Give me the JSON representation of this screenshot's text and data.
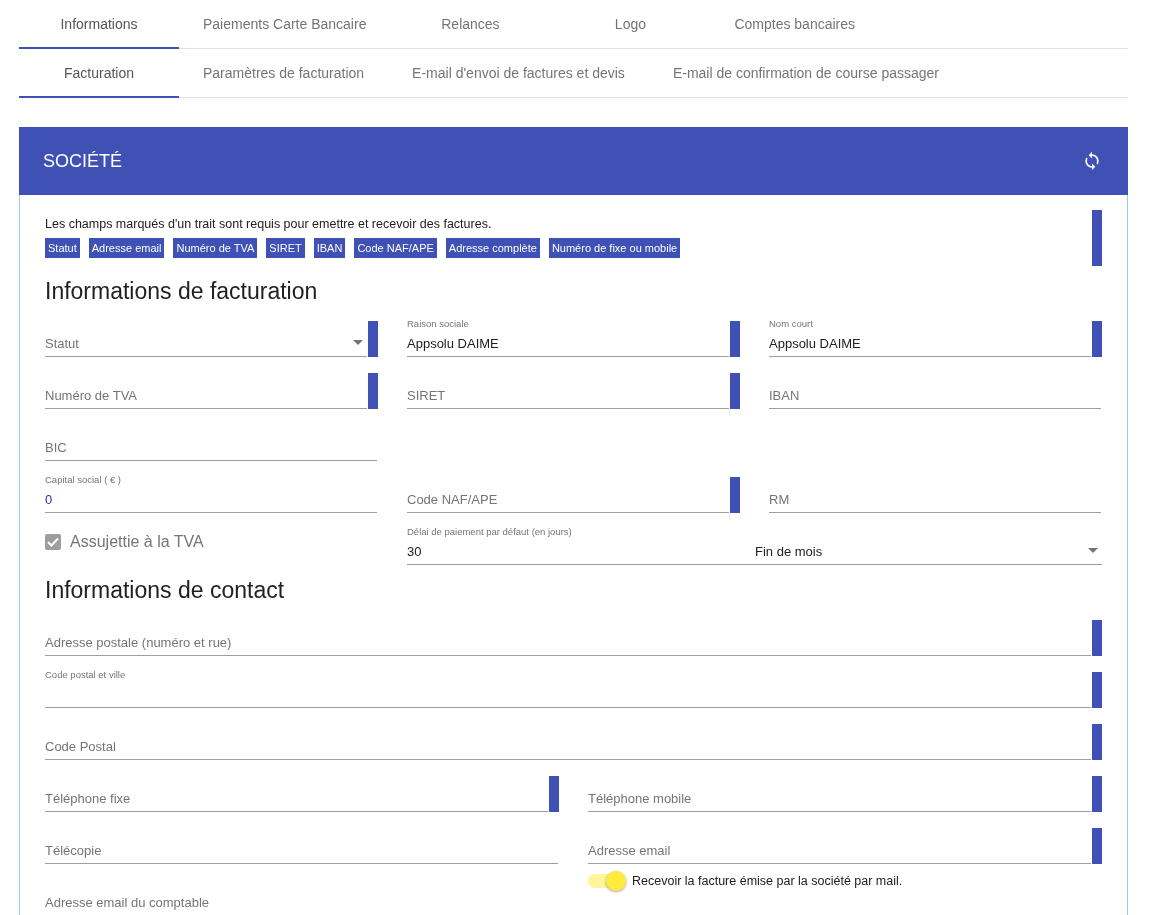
{
  "main_tabs": [
    {
      "label": "Informations",
      "selected": true
    },
    {
      "label": "Paiements Carte Bancaire",
      "selected": false
    },
    {
      "label": "Relances",
      "selected": false
    },
    {
      "label": "Logo",
      "selected": false
    },
    {
      "label": "Comptes bancaires",
      "selected": false
    }
  ],
  "sub_tabs": [
    {
      "label": "Facturation",
      "selected": true
    },
    {
      "label": "Paramètres de facturation",
      "selected": false
    },
    {
      "label": "E-mail d'envoi de factures et devis",
      "selected": false
    },
    {
      "label": "E-mail de confirmation de course passager",
      "selected": false
    }
  ],
  "card": {
    "title": "SOCIÉTÉ",
    "notice": "Les champs marqués d'un trait sont requis pour emettre et recevoir des factures.",
    "required_tags": [
      "Statut",
      "Adresse email",
      "Numéro de TVA",
      "SIRET",
      "IBAN",
      "Code NAF/APE",
      "Adresse complète",
      "Numéro de fixe ou mobile"
    ],
    "sections": [
      {
        "title": "Informations de facturation",
        "rows": [
          [
            {
              "kind": "select",
              "label": "Statut",
              "floated": false,
              "required": true
            },
            {
              "kind": "text",
              "label": "Raison sociale",
              "value": "Appsolu DAIME",
              "floated": true,
              "required": true
            },
            {
              "kind": "text",
              "label": "Nom court",
              "value": "Appsolu DAIME",
              "floated": true,
              "required": true
            }
          ],
          [
            {
              "kind": "text",
              "label": "Numéro de TVA",
              "floated": false,
              "required": true
            },
            {
              "kind": "text",
              "label": "SIRET",
              "floated": false,
              "required": true
            },
            {
              "kind": "text",
              "label": "IBAN",
              "floated": false,
              "required": false
            }
          ],
          [
            {
              "kind": "text",
              "label": "BIC",
              "floated": false,
              "required": false
            },
            {
              "kind": "empty"
            },
            {
              "kind": "empty"
            }
          ],
          [
            {
              "kind": "text",
              "label": "Capital social ( € )",
              "value": "0",
              "floated": true,
              "required": false
            },
            {
              "kind": "text",
              "label": "Code NAF/APE",
              "floated": false,
              "required": true
            },
            {
              "kind": "text",
              "label": "RM",
              "floated": false,
              "required": false
            }
          ],
          [
            {
              "kind": "checkbox",
              "label": "Assujettie à la TVA",
              "checked": true,
              "disabled": true
            },
            {
              "kind": "delay",
              "label": "Délai de paiement par défaut (en jours)",
              "value": "30",
              "option": "Fin de mois"
            }
          ]
        ]
      },
      {
        "title": "Informations de contact",
        "rows": [
          [
            {
              "kind": "text",
              "label": "Adresse postale (numéro et rue)",
              "floated": false,
              "required": true
            }
          ],
          [
            {
              "kind": "text",
              "label": "Code postal et ville",
              "floated": true,
              "required": true
            }
          ],
          [
            {
              "kind": "text",
              "label": "Code Postal",
              "floated": false,
              "required": true
            }
          ],
          [
            {
              "kind": "text",
              "label": "Téléphone fixe",
              "floated": false,
              "required": true
            },
            {
              "kind": "text",
              "label": "Téléphone mobile",
              "floated": false,
              "required": true
            }
          ],
          [
            {
              "kind": "text",
              "label": "Télécopie",
              "floated": false,
              "required": false
            },
            {
              "kind": "text",
              "label": "Adresse email",
              "floated": false,
              "required": true
            }
          ],
          [
            {
              "kind": "text",
              "label": "Adresse email du comptable",
              "floated": false,
              "required": false
            },
            {
              "kind": "toggle",
              "label": "Recevoir la facture émise par la société par mail.",
              "on": true
            }
          ]
        ]
      }
    ]
  }
}
